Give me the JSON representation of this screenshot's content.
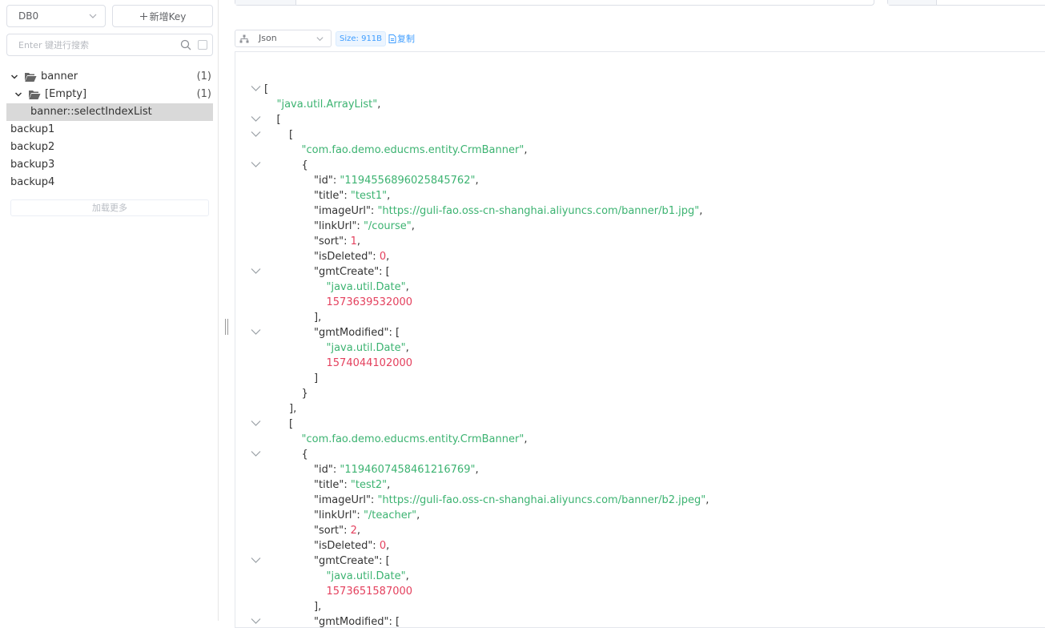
{
  "sidebar": {
    "db_select": {
      "value": "DB0"
    },
    "new_key_button": {
      "icon": "plus-icon",
      "label": "新增Key"
    },
    "search": {
      "placeholder": "Enter 键进行搜索"
    },
    "tree": [
      {
        "label": "banner",
        "count": "(1)"
      },
      {
        "label": "[Empty]",
        "count": "(1)"
      },
      {
        "label": "banner::selectIndexList"
      }
    ],
    "root_keys": [
      "backup1",
      "backup2",
      "backup3",
      "backup4"
    ],
    "load_more_label": "加载更多"
  },
  "viewer": {
    "format_select": {
      "value": "Json"
    },
    "size_tag": "Size: 911B",
    "copy_label": "复制"
  },
  "colors": {
    "string": "#3cb371",
    "number": "#e4415e",
    "accent": "#409eff"
  },
  "json_lines": [
    {
      "indent": 0,
      "fold": true,
      "parts": [
        [
          "p",
          "["
        ]
      ]
    },
    {
      "indent": 1,
      "fold": false,
      "parts": [
        [
          "s",
          "\"java.util.ArrayList\""
        ],
        [
          "p",
          ","
        ]
      ]
    },
    {
      "indent": 1,
      "fold": true,
      "parts": [
        [
          "p",
          "["
        ]
      ]
    },
    {
      "indent": 2,
      "fold": true,
      "parts": [
        [
          "p",
          "["
        ]
      ]
    },
    {
      "indent": 3,
      "fold": false,
      "parts": [
        [
          "s",
          "\"com.fao.demo.educms.entity.CrmBanner\""
        ],
        [
          "p",
          ","
        ]
      ]
    },
    {
      "indent": 3,
      "fold": true,
      "parts": [
        [
          "p",
          "{"
        ]
      ]
    },
    {
      "indent": 4,
      "fold": false,
      "parts": [
        [
          "p",
          "\"id\": "
        ],
        [
          "s",
          "\"1194556896025845762\""
        ],
        [
          "p",
          ","
        ]
      ]
    },
    {
      "indent": 4,
      "fold": false,
      "parts": [
        [
          "p",
          "\"title\": "
        ],
        [
          "s",
          "\"test1\""
        ],
        [
          "p",
          ","
        ]
      ]
    },
    {
      "indent": 4,
      "fold": false,
      "parts": [
        [
          "p",
          "\"imageUrl\": "
        ],
        [
          "s",
          "\"https://guli-fao.oss-cn-shanghai.aliyuncs.com/banner/b1.jpg\""
        ],
        [
          "p",
          ","
        ]
      ]
    },
    {
      "indent": 4,
      "fold": false,
      "parts": [
        [
          "p",
          "\"linkUrl\": "
        ],
        [
          "s",
          "\"/course\""
        ],
        [
          "p",
          ","
        ]
      ]
    },
    {
      "indent": 4,
      "fold": false,
      "parts": [
        [
          "p",
          "\"sort\": "
        ],
        [
          "n",
          "1"
        ],
        [
          "p",
          ","
        ]
      ]
    },
    {
      "indent": 4,
      "fold": false,
      "parts": [
        [
          "p",
          "\"isDeleted\": "
        ],
        [
          "n",
          "0"
        ],
        [
          "p",
          ","
        ]
      ]
    },
    {
      "indent": 4,
      "fold": true,
      "parts": [
        [
          "p",
          "\"gmtCreate\": ["
        ]
      ]
    },
    {
      "indent": 5,
      "fold": false,
      "parts": [
        [
          "s",
          "\"java.util.Date\""
        ],
        [
          "p",
          ","
        ]
      ]
    },
    {
      "indent": 5,
      "fold": false,
      "parts": [
        [
          "n",
          "1573639532000"
        ]
      ]
    },
    {
      "indent": 4,
      "fold": false,
      "parts": [
        [
          "p",
          "],"
        ]
      ]
    },
    {
      "indent": 4,
      "fold": true,
      "parts": [
        [
          "p",
          "\"gmtModified\": ["
        ]
      ]
    },
    {
      "indent": 5,
      "fold": false,
      "parts": [
        [
          "s",
          "\"java.util.Date\""
        ],
        [
          "p",
          ","
        ]
      ]
    },
    {
      "indent": 5,
      "fold": false,
      "parts": [
        [
          "n",
          "1574044102000"
        ]
      ]
    },
    {
      "indent": 4,
      "fold": false,
      "parts": [
        [
          "p",
          "]"
        ]
      ]
    },
    {
      "indent": 3,
      "fold": false,
      "parts": [
        [
          "p",
          "}"
        ]
      ]
    },
    {
      "indent": 2,
      "fold": false,
      "parts": [
        [
          "p",
          "],"
        ]
      ]
    },
    {
      "indent": 2,
      "fold": true,
      "parts": [
        [
          "p",
          "["
        ]
      ]
    },
    {
      "indent": 3,
      "fold": false,
      "parts": [
        [
          "s",
          "\"com.fao.demo.educms.entity.CrmBanner\""
        ],
        [
          "p",
          ","
        ]
      ]
    },
    {
      "indent": 3,
      "fold": true,
      "parts": [
        [
          "p",
          "{"
        ]
      ]
    },
    {
      "indent": 4,
      "fold": false,
      "parts": [
        [
          "p",
          "\"id\": "
        ],
        [
          "s",
          "\"1194607458461216769\""
        ],
        [
          "p",
          ","
        ]
      ]
    },
    {
      "indent": 4,
      "fold": false,
      "parts": [
        [
          "p",
          "\"title\": "
        ],
        [
          "s",
          "\"test2\""
        ],
        [
          "p",
          ","
        ]
      ]
    },
    {
      "indent": 4,
      "fold": false,
      "parts": [
        [
          "p",
          "\"imageUrl\": "
        ],
        [
          "s",
          "\"https://guli-fao.oss-cn-shanghai.aliyuncs.com/banner/b2.jpeg\""
        ],
        [
          "p",
          ","
        ]
      ]
    },
    {
      "indent": 4,
      "fold": false,
      "parts": [
        [
          "p",
          "\"linkUrl\": "
        ],
        [
          "s",
          "\"/teacher\""
        ],
        [
          "p",
          ","
        ]
      ]
    },
    {
      "indent": 4,
      "fold": false,
      "parts": [
        [
          "p",
          "\"sort\": "
        ],
        [
          "n",
          "2"
        ],
        [
          "p",
          ","
        ]
      ]
    },
    {
      "indent": 4,
      "fold": false,
      "parts": [
        [
          "p",
          "\"isDeleted\": "
        ],
        [
          "n",
          "0"
        ],
        [
          "p",
          ","
        ]
      ]
    },
    {
      "indent": 4,
      "fold": true,
      "parts": [
        [
          "p",
          "\"gmtCreate\": ["
        ]
      ]
    },
    {
      "indent": 5,
      "fold": false,
      "parts": [
        [
          "s",
          "\"java.util.Date\""
        ],
        [
          "p",
          ","
        ]
      ]
    },
    {
      "indent": 5,
      "fold": false,
      "parts": [
        [
          "n",
          "1573651587000"
        ]
      ]
    },
    {
      "indent": 4,
      "fold": false,
      "parts": [
        [
          "p",
          "],"
        ]
      ]
    },
    {
      "indent": 4,
      "fold": true,
      "parts": [
        [
          "p",
          "\"gmtModified\": ["
        ]
      ]
    }
  ]
}
